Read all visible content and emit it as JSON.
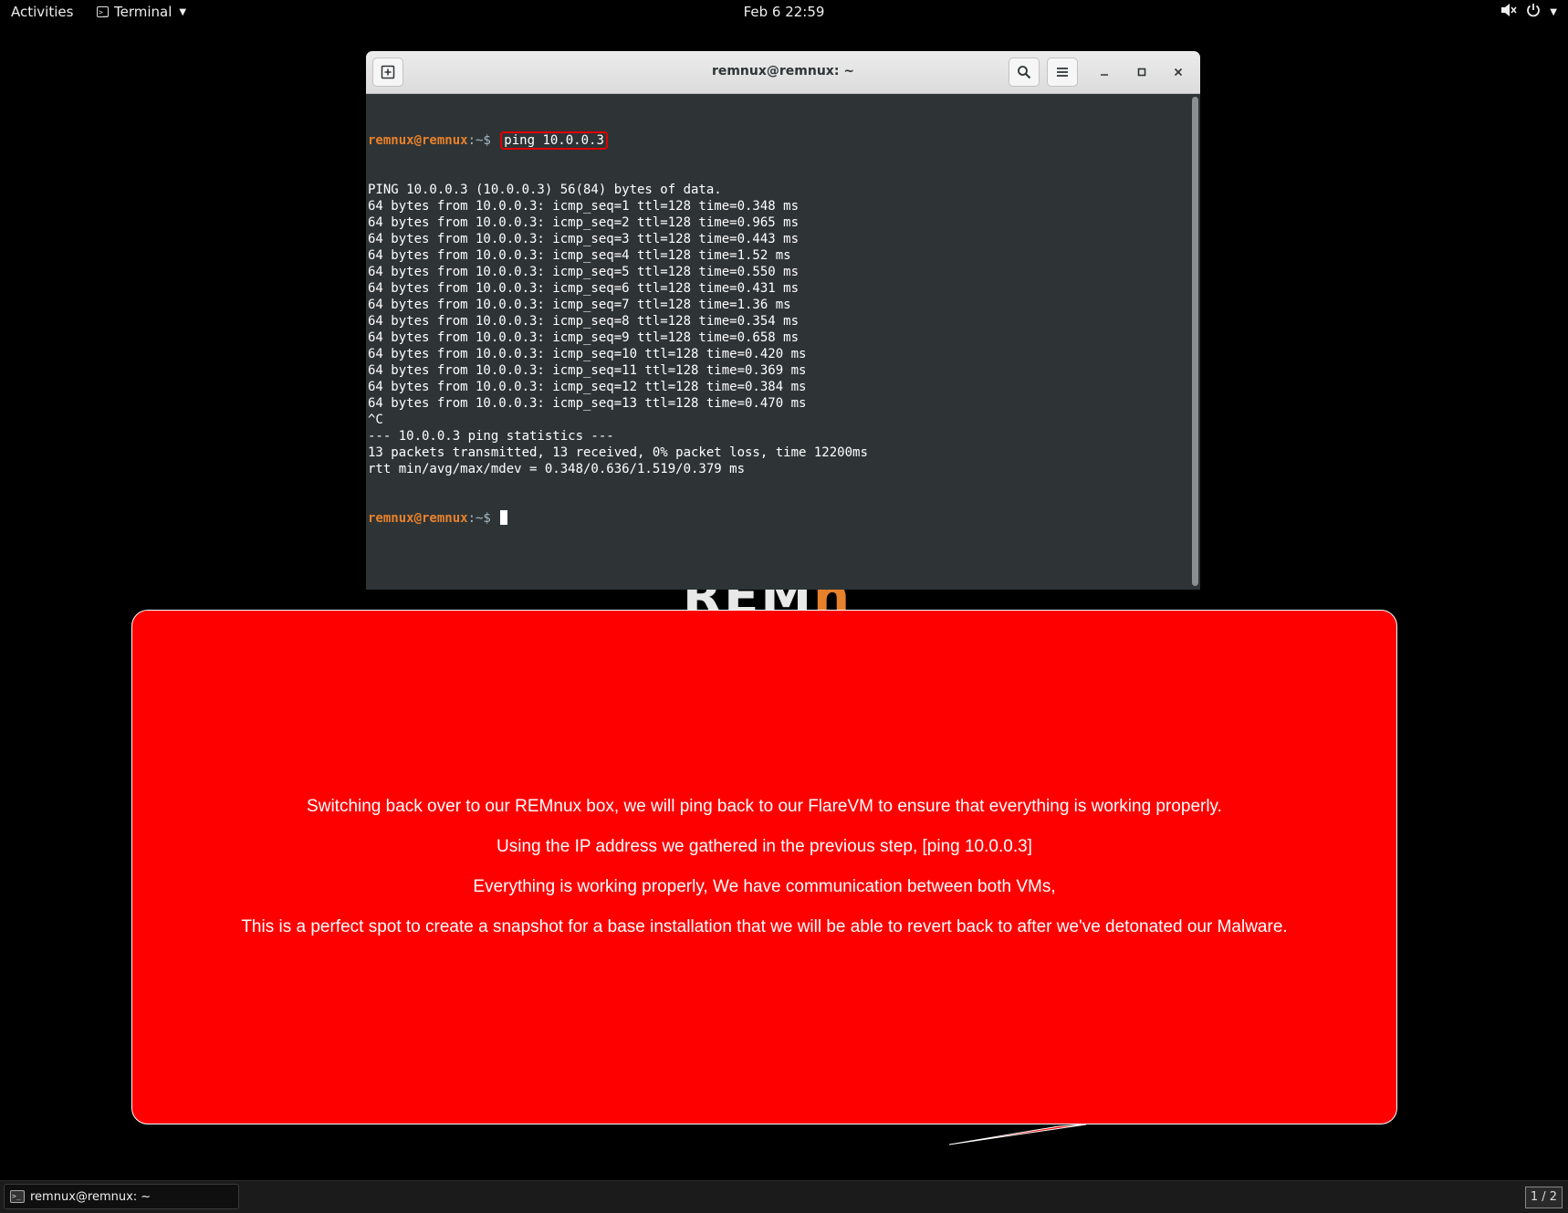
{
  "topbar": {
    "activities": "Activities",
    "app_name": "Terminal",
    "clock": "Feb 6  22:59",
    "icons": [
      "speaker-icon",
      "power-icon",
      "chevron-down-icon"
    ]
  },
  "terminal": {
    "title": "remnux@remnux: ~",
    "prompt_user": "remnux@remnux",
    "prompt_path": ":~$ ",
    "command": "ping 10.0.0.3",
    "output": [
      "PING 10.0.0.3 (10.0.0.3) 56(84) bytes of data.",
      "64 bytes from 10.0.0.3: icmp_seq=1 ttl=128 time=0.348 ms",
      "64 bytes from 10.0.0.3: icmp_seq=2 ttl=128 time=0.965 ms",
      "64 bytes from 10.0.0.3: icmp_seq=3 ttl=128 time=0.443 ms",
      "64 bytes from 10.0.0.3: icmp_seq=4 ttl=128 time=1.52 ms",
      "64 bytes from 10.0.0.3: icmp_seq=5 ttl=128 time=0.550 ms",
      "64 bytes from 10.0.0.3: icmp_seq=6 ttl=128 time=0.431 ms",
      "64 bytes from 10.0.0.3: icmp_seq=7 ttl=128 time=1.36 ms",
      "64 bytes from 10.0.0.3: icmp_seq=8 ttl=128 time=0.354 ms",
      "64 bytes from 10.0.0.3: icmp_seq=9 ttl=128 time=0.658 ms",
      "64 bytes from 10.0.0.3: icmp_seq=10 ttl=128 time=0.420 ms",
      "64 bytes from 10.0.0.3: icmp_seq=11 ttl=128 time=0.369 ms",
      "64 bytes from 10.0.0.3: icmp_seq=12 ttl=128 time=0.384 ms",
      "64 bytes from 10.0.0.3: icmp_seq=13 ttl=128 time=0.470 ms",
      "^C",
      "--- 10.0.0.3 ping statistics ---",
      "13 packets transmitted, 13 received, 0% packet loss, time 12200ms",
      "rtt min/avg/max/mdev = 0.348/0.636/1.519/0.379 ms"
    ]
  },
  "background_logo": {
    "text": "REM",
    "accent": "n"
  },
  "callout": {
    "lines": [
      "Switching back over to our REMnux box, we will ping back to our FlareVM to ensure that everything is working properly.",
      "Using the IP address we gathered in the previous step, [ping 10.0.0.3]",
      "Everything is working properly, We have communication between both VMs,",
      "This is a perfect spot to create a snapshot for a base installation that we will be able to revert back to after we've detonated our Malware."
    ],
    "color": "#ff0000"
  },
  "taskbar": {
    "task_label": "remnux@remnux: ~",
    "workspace": "1 / 2"
  },
  "colors": {
    "terminal_bg": "#2e3436",
    "prompt_user": "#e8812b",
    "highlight_box": "#e00000"
  }
}
